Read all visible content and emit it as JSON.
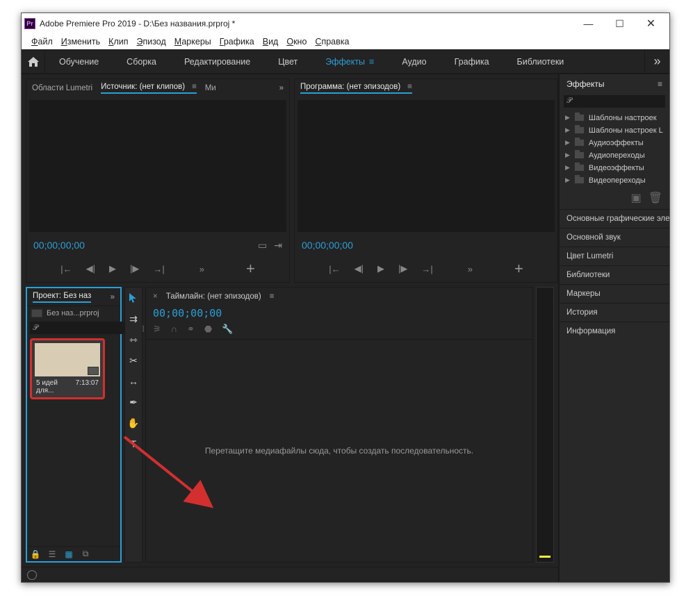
{
  "titlebar": {
    "app_name": "Adobe Premiere Pro 2019",
    "project_path": "D:\\Без названия.prproj *"
  },
  "menubar": {
    "items": [
      "Файл",
      "Изменить",
      "Клип",
      "Эпизод",
      "Маркеры",
      "Графика",
      "Вид",
      "Окно",
      "Справка"
    ]
  },
  "workspaces": {
    "items": [
      "Обучение",
      "Сборка",
      "Редактирование",
      "Цвет",
      "Эффекты",
      "Аудио",
      "Графика",
      "Библиотеки"
    ],
    "active_index": 4
  },
  "source_panel": {
    "tabs": [
      "Области Lumetri",
      "Источник: (нет клипов)",
      "Ми"
    ],
    "active_index": 1,
    "timecode": "00;00;00;00"
  },
  "program_panel": {
    "title": "Программа: (нет эпизодов)",
    "timecode": "00;00;00;00"
  },
  "project_panel": {
    "title": "Проект: Без наз",
    "filename": "Без наз...prproj",
    "clip_name": "5 идей для...",
    "clip_duration": "7:13:07",
    "search_placeholder": ""
  },
  "timeline_panel": {
    "title": "Таймлайн: (нет эпизодов)",
    "timecode": "00;00;00;00",
    "drop_message": "Перетащите медиафайлы сюда, чтобы создать последовательность."
  },
  "effects_panel": {
    "title": "Эффекты",
    "search_placeholder": "",
    "folders": [
      "Шаблоны настроек",
      "Шаблоны настроек L",
      "Аудиоэффекты",
      "Аудиопереходы",
      "Видеоэффекты",
      "Видеопереходы"
    ]
  },
  "right_panels": [
    "Основные графические эле",
    "Основной звук",
    "Цвет Lumetri",
    "Библиотеки",
    "Маркеры",
    "История",
    "Информация"
  ]
}
